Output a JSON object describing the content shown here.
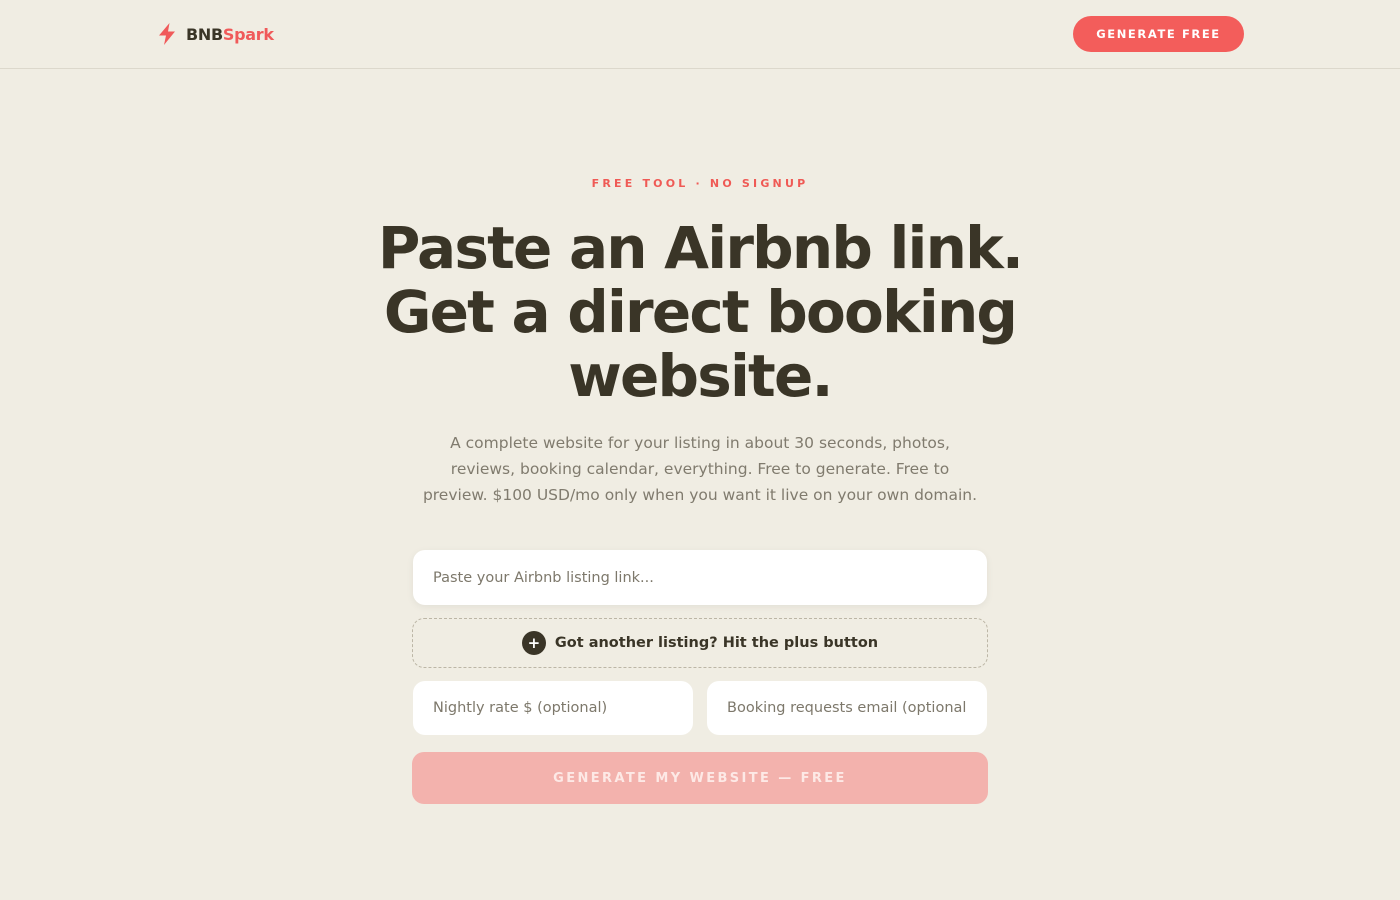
{
  "header": {
    "brand_part1": "BNB",
    "brand_part2": "Spark",
    "cta_label": "GENERATE FREE",
    "logo_icon": "lightning-bolt-icon"
  },
  "hero": {
    "eyebrow": "FREE TOOL · NO SIGNUP",
    "headline_lines": [
      "Paste an Airbnb link.",
      "Get a direct booking",
      "website."
    ],
    "subtext_lines": [
      "A complete website for your listing in about 30 seconds, photos,",
      "reviews, booking calendar, everything. Free to generate. Free to",
      "preview. $100 USD/mo only when you want it live on your own domain."
    ]
  },
  "form": {
    "url_placeholder": "Paste your Airbnb listing link...",
    "add_listing_label": "Got another listing? Hit the plus button",
    "add_icon": "plus-icon",
    "nightly_rate_placeholder": "Nightly rate $ (optional)",
    "email_placeholder": "Booking requests email (optional)",
    "submit_label": "GENERATE MY WEBSITE — FREE"
  },
  "colors": {
    "background": "#f0ede3",
    "accent": "#f35d5b",
    "text_dark": "#3a3527",
    "text_muted": "#807b6e",
    "button_disabled": "#f3b2ad"
  }
}
